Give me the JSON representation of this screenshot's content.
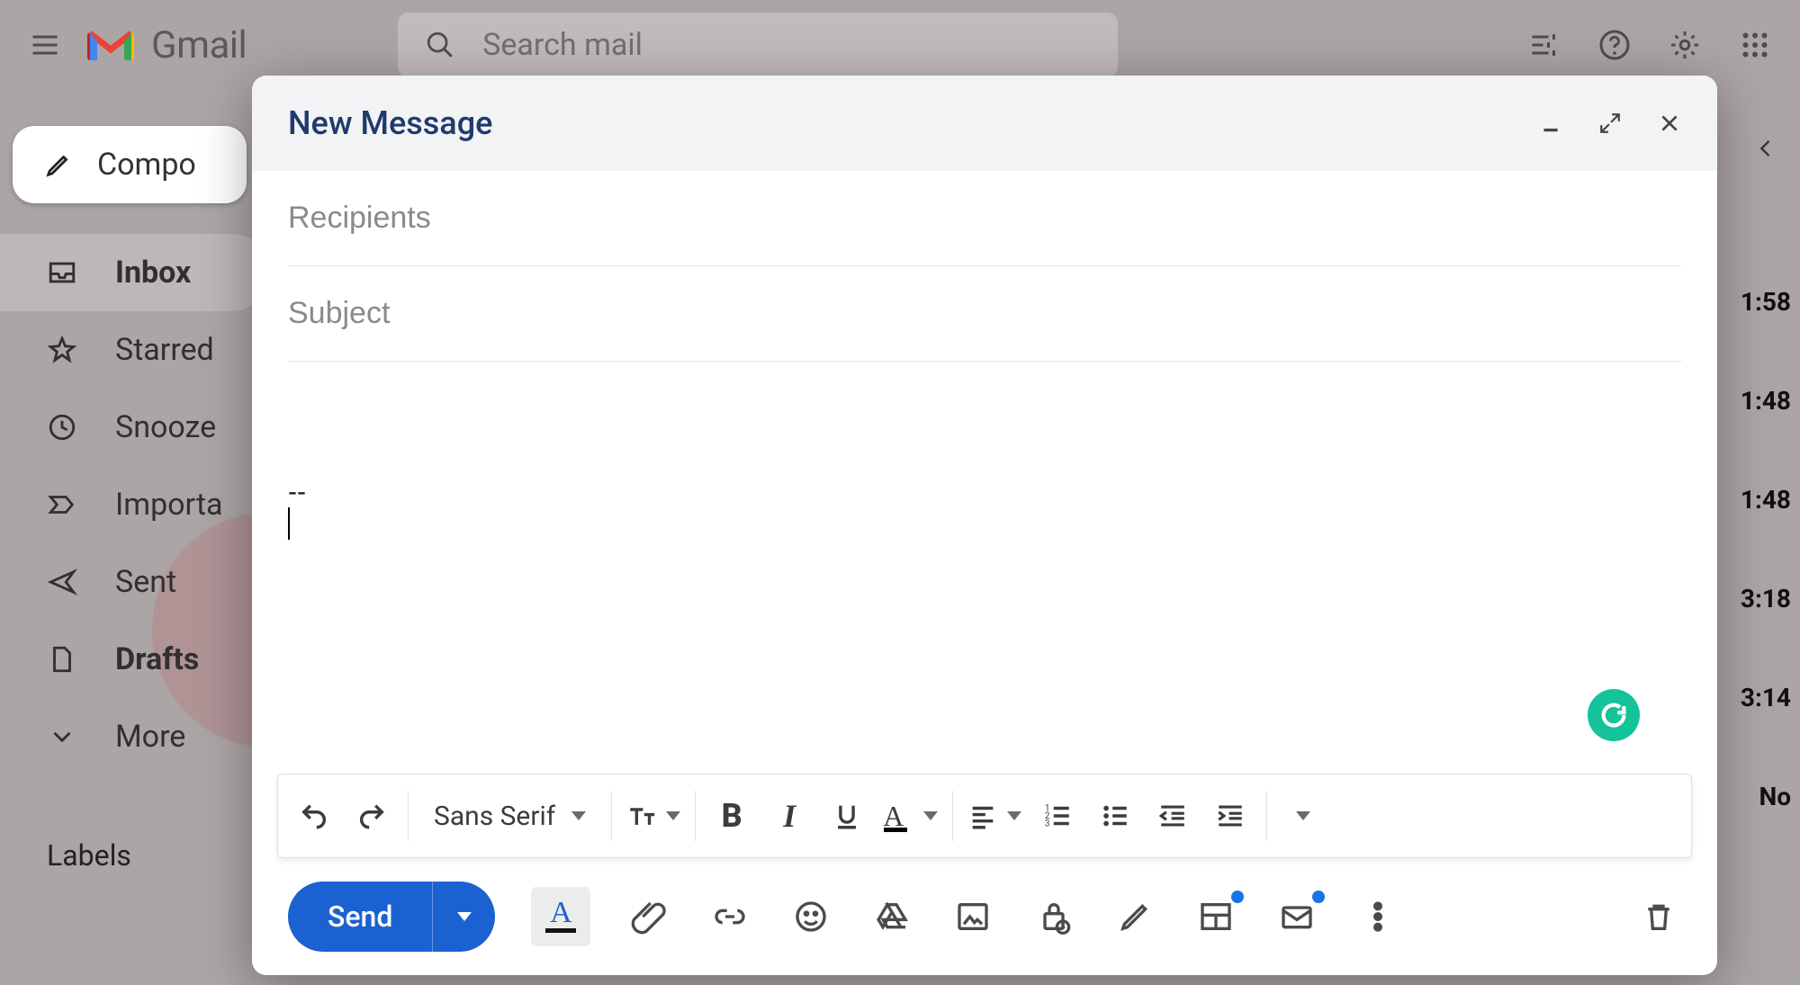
{
  "header": {
    "product_name": "Gmail",
    "search_placeholder": "Search mail"
  },
  "sidebar": {
    "compose_label": "Compo",
    "items": [
      {
        "label": "Inbox",
        "icon": "inbox",
        "active": true,
        "bold": true
      },
      {
        "label": "Starred",
        "icon": "star",
        "active": false,
        "bold": false
      },
      {
        "label": "Snooze",
        "icon": "clock",
        "active": false,
        "bold": false
      },
      {
        "label": "Importa",
        "icon": "important",
        "active": false,
        "bold": false
      },
      {
        "label": "Sent",
        "icon": "send",
        "active": false,
        "bold": false
      },
      {
        "label": "Drafts",
        "icon": "file",
        "active": false,
        "bold": true
      },
      {
        "label": "More",
        "icon": "chevron",
        "active": false,
        "bold": false
      }
    ],
    "labels_header": "Labels"
  },
  "right_times": [
    "1:58",
    "1:48",
    "1:48",
    "3:18",
    "3:14",
    "No"
  ],
  "compose": {
    "title": "New Message",
    "recipients_placeholder": "Recipients",
    "subject_placeholder": "Subject",
    "recipients_value": "",
    "subject_value": "",
    "body_signature_sep": "--",
    "font_name": "Sans Serif",
    "send_label": "Send",
    "grammarly_color": "#15c39a"
  }
}
